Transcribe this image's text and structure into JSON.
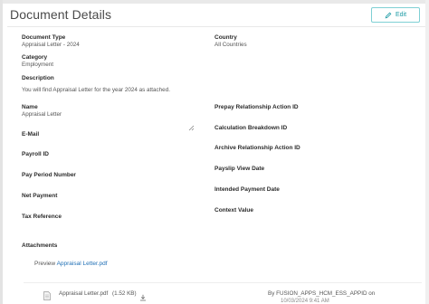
{
  "header": {
    "title": "Document Details",
    "edit_label": "Edit"
  },
  "fields": {
    "document_type": {
      "label": "Document Type",
      "value": "Appraisal Letter - 2024"
    },
    "country": {
      "label": "Country",
      "value": "All Countries"
    },
    "category": {
      "label": "Category",
      "value": "Employment"
    },
    "description": {
      "label": "Description",
      "value": "You will find Appraisal Letter for the year 2024 as attached."
    },
    "name": {
      "label": "Name",
      "value": "Appraisal Letter"
    },
    "prepay_relationship_action_id": {
      "label": "Prepay Relationship Action ID"
    },
    "calculation_breakdown_id": {
      "label": "Calculation Breakdown ID"
    },
    "email": {
      "label": "E-Mail"
    },
    "archive_relationship_action_id": {
      "label": "Archive Relationship Action ID"
    },
    "payroll_id": {
      "label": "Payroll ID"
    },
    "payslip_view_date": {
      "label": "Payslip View Date"
    },
    "pay_period_number": {
      "label": "Pay Period Number"
    },
    "intended_payment_date": {
      "label": "Intended Payment Date"
    },
    "net_payment": {
      "label": "Net Payment"
    },
    "context_value": {
      "label": "Context Value"
    },
    "tax_reference": {
      "label": "Tax Reference"
    }
  },
  "attachments": {
    "label": "Attachments",
    "preview_prefix": "Preview",
    "preview_link": "Appraisal Letter.pdf",
    "file": {
      "name": "Appraisal Letter.pdf",
      "size": "(1.52 KB)",
      "uploaded_by": "By FUSION_APPS_HCM_ESS_APPID on",
      "uploaded_on": "10/03/2024 9:41 AM"
    }
  },
  "colors": {
    "accent": "#1a9aa4",
    "link": "#1f6fb5"
  }
}
